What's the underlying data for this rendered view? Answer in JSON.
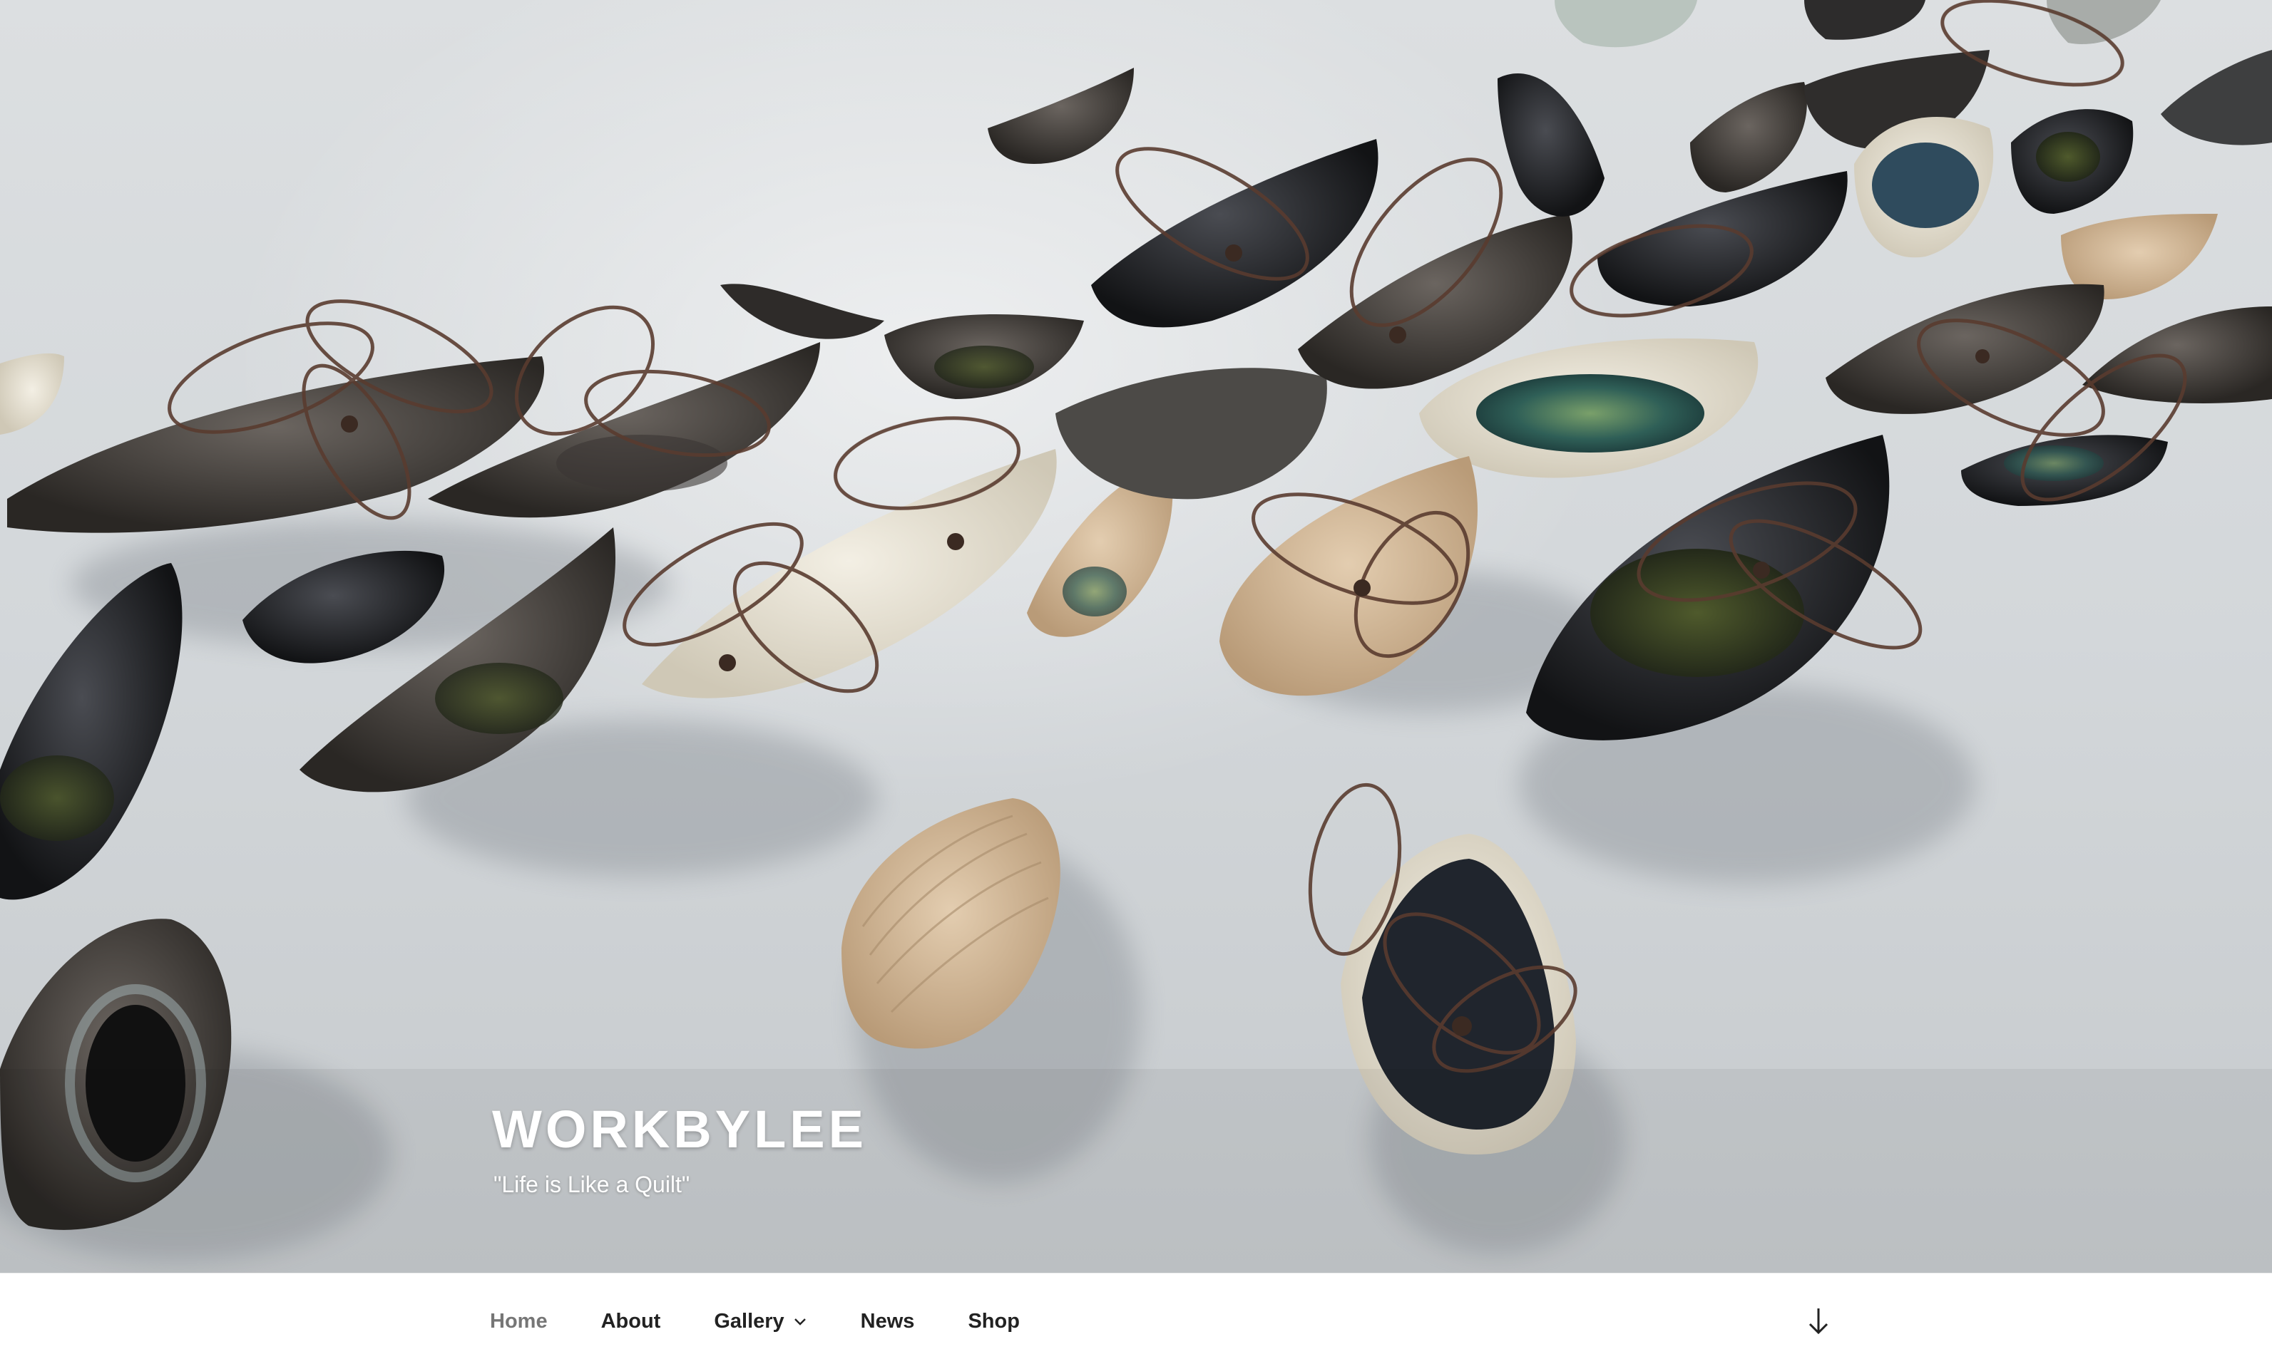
{
  "site": {
    "title": "WORKBYLEE",
    "description": "\"Life is Like a Quilt\""
  },
  "header_image": {
    "subject": "ceramic-dishes-with-wire-flowers-icon"
  },
  "navigation": {
    "items": [
      {
        "label": "Home",
        "current": true,
        "has_submenu": false
      },
      {
        "label": "About",
        "current": false,
        "has_submenu": false
      },
      {
        "label": "Gallery",
        "current": false,
        "has_submenu": true
      },
      {
        "label": "News",
        "current": false,
        "has_submenu": false
      },
      {
        "label": "Shop",
        "current": false,
        "has_submenu": false
      }
    ],
    "scroll_icon": "arrow-down-icon"
  },
  "colors": {
    "text_dark": "#222222",
    "text_current": "#767676",
    "background_nav": "#ffffff",
    "hero_background": "#d3d7da"
  }
}
